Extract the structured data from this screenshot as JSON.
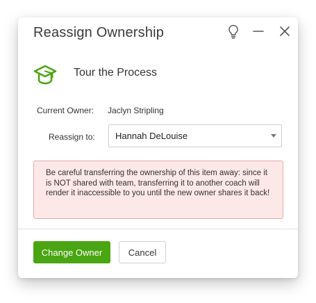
{
  "dialog": {
    "title": "Reassign Ownership",
    "header_icons": [
      "lightbulb-icon",
      "minimize-icon",
      "close-icon"
    ]
  },
  "item": {
    "icon": "graduation-cap-icon",
    "name": "Tour the Process"
  },
  "owner": {
    "label": "Current Owner:",
    "value": "Jaclyn Stripling"
  },
  "reassign": {
    "label": "Reassign to:",
    "selected": "Hannah DeLouise"
  },
  "warning": {
    "text": "Be careful transferring the ownership of this item away: since it is NOT shared with team, transferring it to another coach will render it inaccessible to you until the new owner shares it back!"
  },
  "buttons": {
    "primary_label": "Change Owner",
    "secondary_label": "Cancel"
  },
  "colors": {
    "accent_green": "#49a512",
    "warning_bg": "#fde8e8",
    "warning_border": "#e9a9a9"
  }
}
